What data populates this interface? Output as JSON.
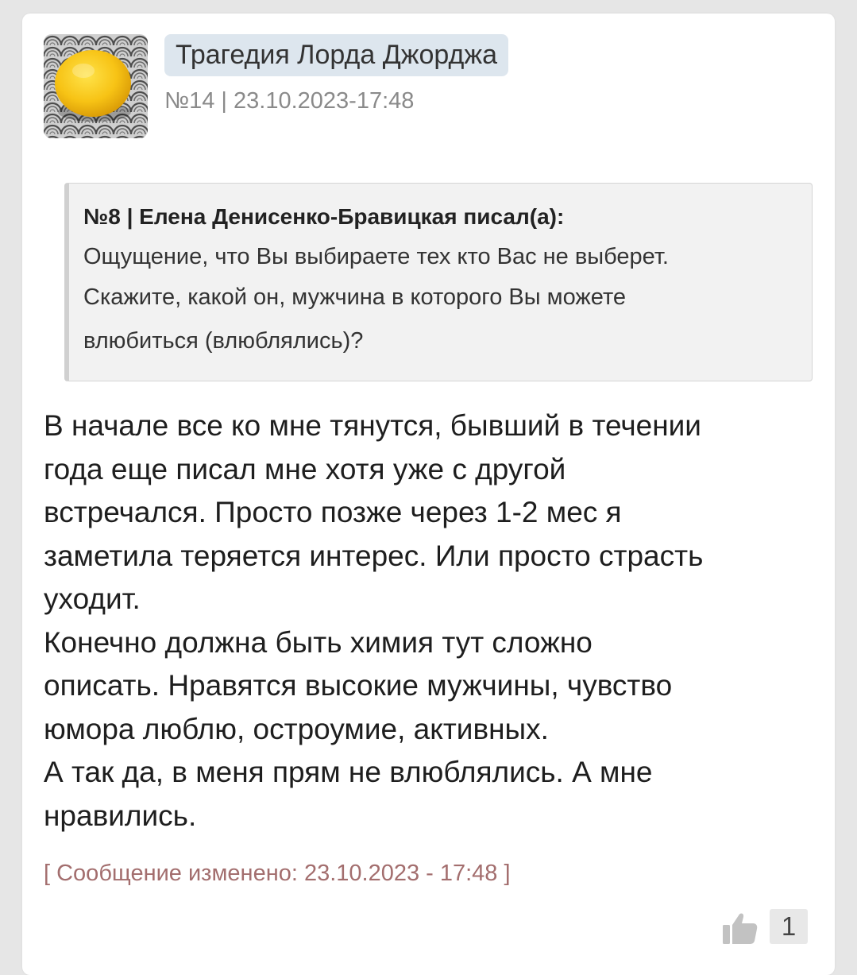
{
  "post": {
    "author": "Трагедия Лорда Джорджа",
    "meta": "№14 | 23.10.2023-17:48",
    "avatar_icon": "lemon-avatar",
    "quote": {
      "header": "№8 | Елена Денисенко-Бравицкая писал(а):",
      "lines": [
        "Ощущение, что Вы выбираете тех кто Вас не выберет.",
        "Скажите, какой он, мужчина в которого Вы можете",
        "влюбиться (влюблялись)?"
      ]
    },
    "body_lines": [
      "В начале все ко мне тянутся, бывший в течении",
      "года еще писал мне хотя уже с другой",
      "встречался. Просто позже через 1-2 мес я",
      "заметила теряется интерес. Или просто страсть",
      "уходит.",
      "Конечно должна быть химия тут сложно",
      "описать. Нравятся высокие мужчины, чувство",
      "юмора люблю, остроумие, активных.",
      "А так да, в меня прям не влюблялись. А мне",
      "нравились."
    ],
    "edited": "[ Сообщение изменено: 23.10.2023 - 17:48 ]",
    "like_icon": "thumbs-up-icon",
    "like_count": "1"
  },
  "colors": {
    "page_background": "#e6e6e6",
    "author_badge": "#dde6ee",
    "edited_text": "#a36e6e",
    "quote_background": "#f2f2f2"
  }
}
